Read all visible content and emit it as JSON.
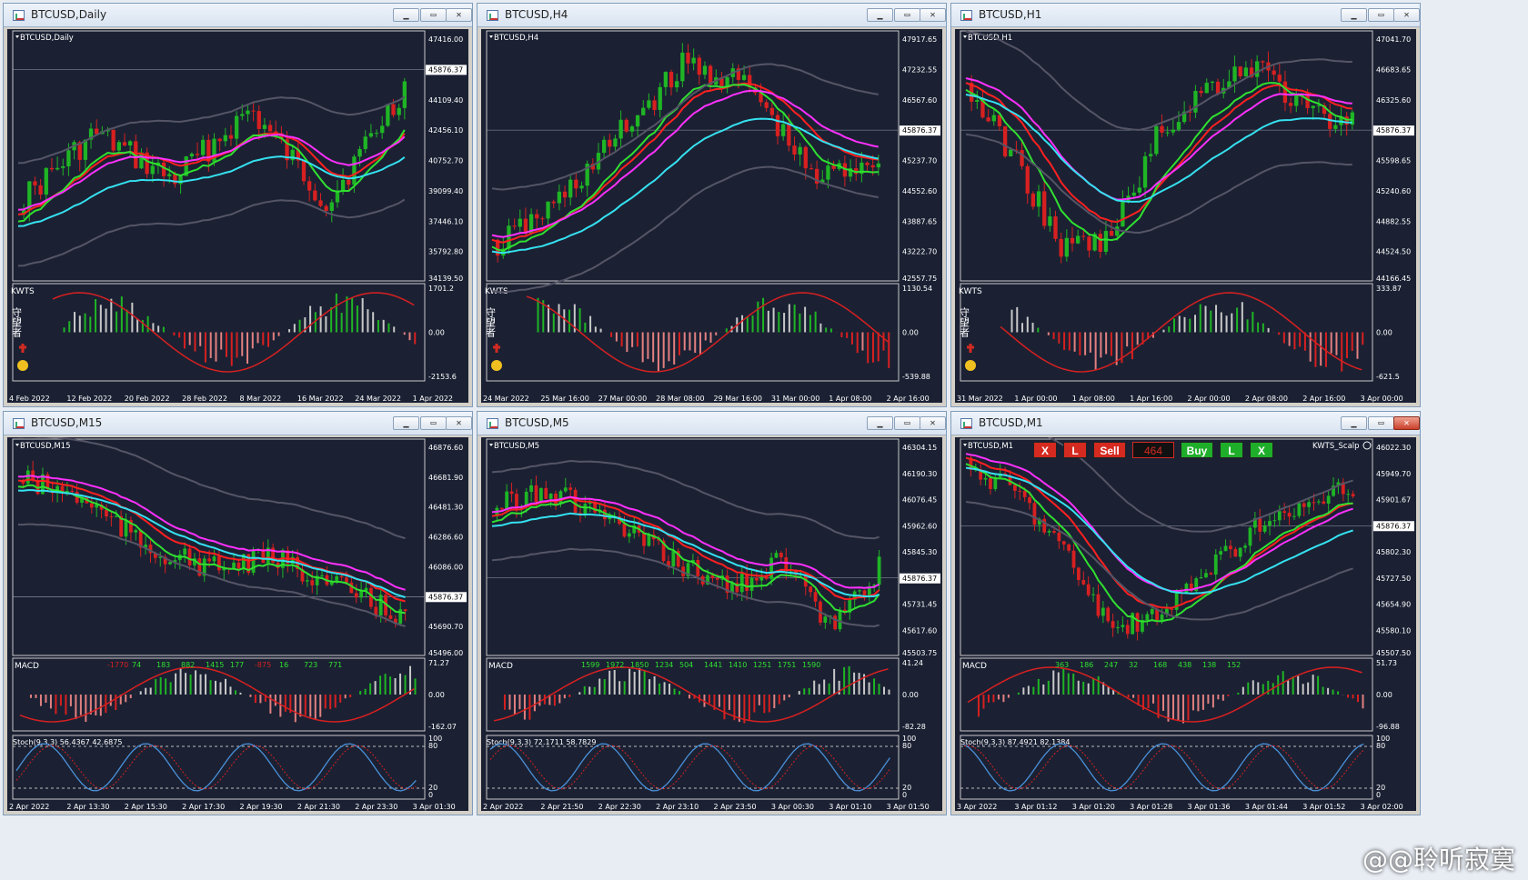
{
  "windows": [
    {
      "title": "BTCUSD,Daily",
      "label": "BTCUSD,Daily",
      "price": "45876.37",
      "axis": [
        "47416.00",
        "45876.37",
        "44109.40",
        "42456.10",
        "40752.70",
        "39099.40",
        "37446.10",
        "35792.80",
        "34139.50"
      ],
      "ind": "KWTS",
      "ind_axis": [
        "1701.2",
        "0.00",
        "-2153.6"
      ],
      "times": [
        "4 Feb 2022",
        "12 Feb 2022",
        "20 Feb 2022",
        "28 Feb 2022",
        "8 Mar 2022",
        "16 Mar 2022",
        "24 Mar 2022",
        "1 Apr 2022"
      ]
    },
    {
      "title": "BTCUSD,H4",
      "label": "BTCUSD,H4",
      "price": "45876.37",
      "axis": [
        "47917.65",
        "47232.55",
        "46567.60",
        "45876.37",
        "45237.70",
        "44552.60",
        "43887.65",
        "43222.70",
        "42557.75"
      ],
      "ind": "KWTS",
      "ind_axis": [
        "1130.54",
        "0.00",
        "-539.88"
      ],
      "times": [
        "24 Mar 2022",
        "25 Mar 16:00",
        "27 Mar 00:00",
        "28 Mar 08:00",
        "29 Mar 16:00",
        "31 Mar 00:00",
        "1 Apr 08:00",
        "2 Apr 16:00"
      ]
    },
    {
      "title": "BTCUSD,H1",
      "label": "BTCUSD,H1",
      "price": "45876.37",
      "axis": [
        "47041.70",
        "46683.65",
        "46325.60",
        "45876.37",
        "45598.65",
        "45240.60",
        "44882.55",
        "44524.50",
        "44166.45"
      ],
      "ind": "KWTS",
      "ind_axis": [
        "333.87",
        "0.00",
        "-621.5"
      ],
      "times": [
        "31 Mar 2022",
        "1 Apr 00:00",
        "1 Apr 08:00",
        "1 Apr 16:00",
        "2 Apr 00:00",
        "2 Apr 08:00",
        "2 Apr 16:00",
        "3 Apr 00:00"
      ]
    },
    {
      "title": "BTCUSD,M15",
      "label": "BTCUSD,M15",
      "price": "45876.37",
      "axis": [
        "46876.60",
        "46681.90",
        "46481.30",
        "46286.60",
        "46086.00",
        "45876.37",
        "45690.70",
        "45496.00"
      ],
      "ind": "MACD",
      "ind_axis": [
        "71.27",
        "0.00",
        "-162.07"
      ],
      "hist_labels": [
        "-1770",
        "74",
        "183",
        "882",
        "1415",
        "177",
        "-875",
        "16",
        "723",
        "771"
      ],
      "stoch": "Stoch(9,3,3) 56.4367 42.6875",
      "stoch_axis": [
        "100",
        "80",
        "20",
        "0"
      ],
      "times": [
        "2 Apr 2022",
        "2 Apr 13:30",
        "2 Apr 15:30",
        "2 Apr 17:30",
        "2 Apr 19:30",
        "2 Apr 21:30",
        "2 Apr 23:30",
        "3 Apr 01:30"
      ]
    },
    {
      "title": "BTCUSD,M5",
      "label": "BTCUSD,M5",
      "price": "45876.37",
      "axis": [
        "46304.15",
        "46190.30",
        "46076.45",
        "45962.60",
        "45845.30",
        "45876.37",
        "45731.45",
        "45617.60",
        "45503.75"
      ],
      "ind": "MACD",
      "ind_axis": [
        "41.24",
        "0.00",
        "-82.28"
      ],
      "hist_labels": [
        "1599",
        "1972",
        "1850",
        "1234",
        "504",
        "1441",
        "1410",
        "1251",
        "1751",
        "1590"
      ],
      "stoch": "Stoch(9,3,3) 72.1711 58.7829",
      "stoch_axis": [
        "100",
        "80",
        "20",
        "0"
      ],
      "times": [
        "2 Apr 2022",
        "2 Apr 21:50",
        "2 Apr 22:30",
        "2 Apr 23:10",
        "2 Apr 23:50",
        "3 Apr 00:30",
        "3 Apr 01:10",
        "3 Apr 01:50"
      ]
    },
    {
      "title": "BTCUSD,M1",
      "label": "BTCUSD,M1",
      "price": "45876.37",
      "axis": [
        "46022.30",
        "45949.70",
        "45901.67",
        "45876.37",
        "45802.30",
        "45727.50",
        "45654.90",
        "45580.10",
        "45507.50"
      ],
      "ind": "MACD",
      "ind_axis": [
        "51.73",
        "0.00",
        "-96.88"
      ],
      "hist_labels": [
        "363",
        "186",
        "247",
        "32",
        "168",
        "438",
        "138",
        "152"
      ],
      "stoch": "Stoch(9,3,3) 87.4921 82.1384",
      "stoch_axis": [
        "100",
        "80",
        "20",
        "0"
      ],
      "times": [
        "3 Apr 2022",
        "3 Apr 01:12",
        "3 Apr 01:20",
        "3 Apr 01:28",
        "3 Apr 01:36",
        "3 Apr 01:44",
        "3 Apr 01:52",
        "3 Apr 02:00"
      ],
      "ea": "KWTS_Scalp"
    }
  ],
  "trade": {
    "close1": "X",
    "lock1": "L",
    "sell": "Sell",
    "spread": "464",
    "buy": "Buy",
    "lock2": "L",
    "close2": "X"
  },
  "kwts_side": "守望者",
  "watermark_text": "@@聆听寂寞",
  "colors": {
    "bg": "#1b2133",
    "bull": "#1fb525",
    "bear": "#d72020",
    "cyan": "#35e1f0",
    "magenta": "#ff30ff",
    "red": "#ff2020",
    "green": "#30e030"
  }
}
